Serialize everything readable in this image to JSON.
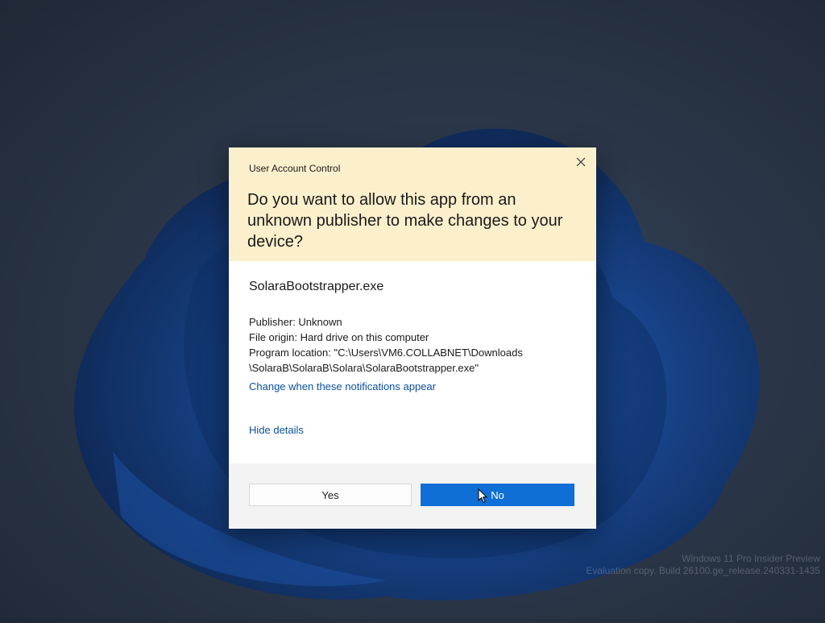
{
  "dialog": {
    "title": "User Account Control",
    "question": "Do you want to allow this app from an unknown publisher to make changes to your device?",
    "app_name": "SolaraBootstrapper.exe",
    "publisher": "Publisher: Unknown",
    "file_origin": "File origin: Hard drive on this computer",
    "program_location_line1": "Program location: \"C:\\Users\\VM6.COLLABNET\\Downloads",
    "program_location_line2": "\\SolaraB\\SolaraB\\Solara\\SolaraBootstrapper.exe\"",
    "change_link": "Change when these notifications appear",
    "hide_details_link": "Hide details",
    "yes_label": "Yes",
    "no_label": "No"
  },
  "watermark": {
    "line1": "Windows 11 Pro Insider Preview",
    "line2": "Evaluation copy. Build 26100.ge_release.240331-1435"
  },
  "colors": {
    "header_bg": "#fcefcc",
    "primary_button": "#0f6fd6",
    "link": "#0a4f9e"
  },
  "icons": {
    "close": "close-icon",
    "cursor": "mouse-pointer-icon"
  }
}
